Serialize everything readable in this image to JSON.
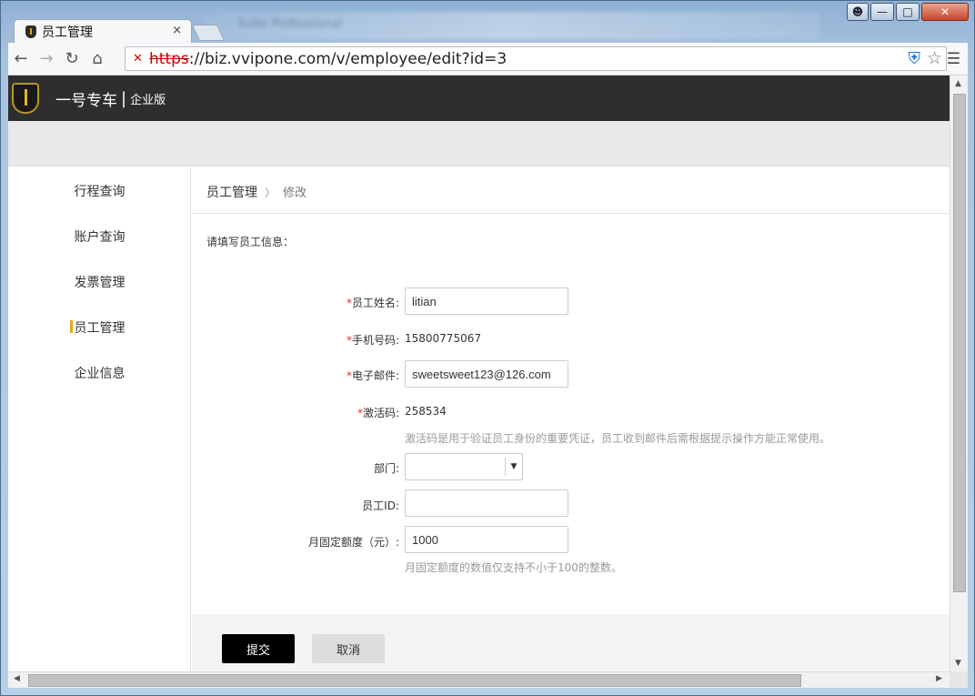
{
  "browser": {
    "tab_title": "员工管理",
    "tab_close": "×",
    "url_scheme": "https",
    "url_rest": "://biz.vvipone.com/v/employee/edit?id=3",
    "background_title": "Suite Professional"
  },
  "site": {
    "brand": "一号专车",
    "brand_separator": "|",
    "edition": "企业版"
  },
  "sidebar": {
    "items": [
      {
        "label": "行程查询"
      },
      {
        "label": "账户查询"
      },
      {
        "label": "发票管理"
      },
      {
        "label": "员工管理",
        "active": true
      },
      {
        "label": "企业信息"
      }
    ]
  },
  "breadcrumb": {
    "parent": "员工管理",
    "separator": "〉",
    "current": "修改"
  },
  "form": {
    "intro": "请填写员工信息：",
    "required_mark": "*",
    "name_label": "员工姓名:",
    "name_value": "litian",
    "phone_label": "手机号码:",
    "phone_value": "15800775067",
    "email_label": "电子邮件:",
    "email_value": "sweetsweet123@126.com",
    "code_label": "激活码:",
    "code_value": "258534",
    "code_hint": "激活码是用于验证员工身份的重要凭证，员工收到邮件后需根据提示操作方能正常使用。",
    "dept_label": "部门:",
    "dept_value": "",
    "empid_label": "员工ID:",
    "empid_value": "",
    "quota_label": "月固定额度（元）:",
    "quota_value": "1000",
    "quota_hint": "月固定额度的数值仅支持不小于100的整数。"
  },
  "actions": {
    "submit": "提交",
    "cancel": "取消"
  },
  "colors": {
    "header_bg": "#2e2e2e",
    "accent": "#e6a817",
    "required": "#ee2233",
    "submit_bg": "#000000"
  }
}
